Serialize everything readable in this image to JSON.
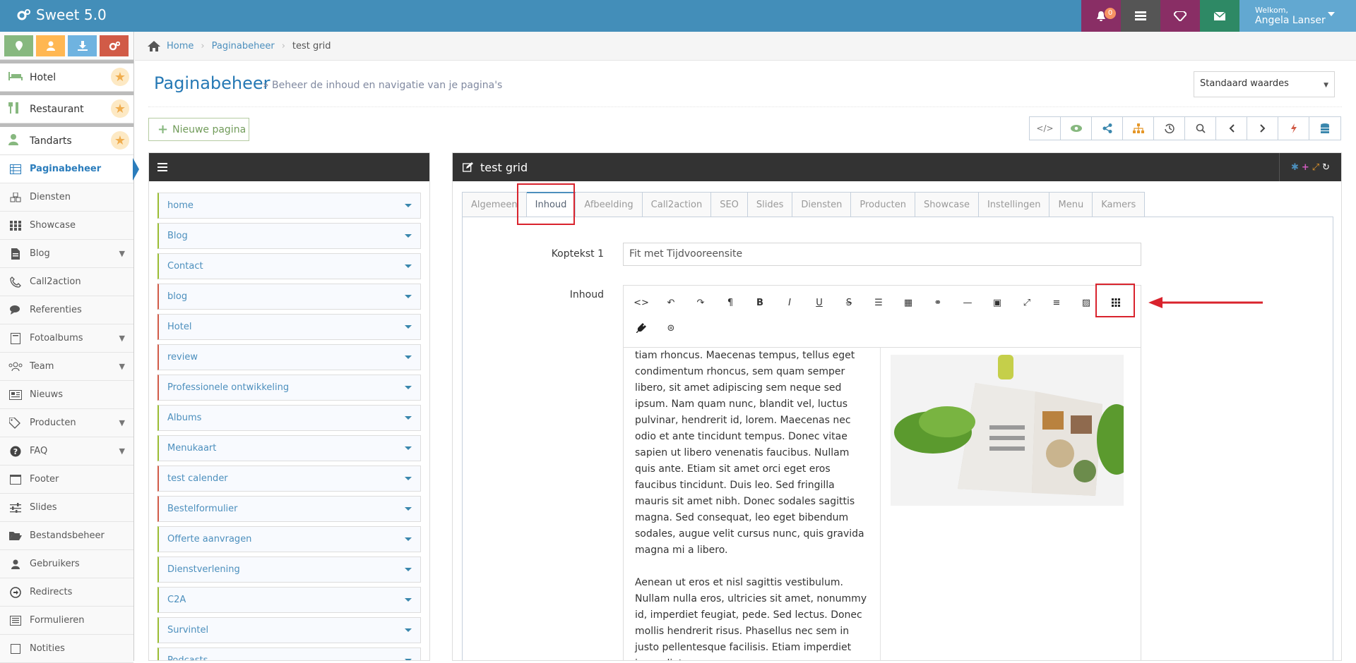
{
  "app": {
    "title": "Sweet 5.0"
  },
  "topbar": {
    "notifications_count": "0",
    "welcome": "Welkom,",
    "user_name": "Angela Lanser"
  },
  "sidebar": {
    "favorites": [
      {
        "label": "Hotel"
      },
      {
        "label": "Restaurant"
      },
      {
        "label": "Tandarts"
      }
    ],
    "items": [
      {
        "label": "Paginabeheer"
      },
      {
        "label": "Diensten"
      },
      {
        "label": "Showcase"
      },
      {
        "label": "Blog"
      },
      {
        "label": "Call2action"
      },
      {
        "label": "Referenties"
      },
      {
        "label": "Fotoalbums"
      },
      {
        "label": "Team"
      },
      {
        "label": "Nieuws"
      },
      {
        "label": "Producten"
      },
      {
        "label": "FAQ"
      },
      {
        "label": "Footer"
      },
      {
        "label": "Slides"
      },
      {
        "label": "Bestandsbeheer"
      },
      {
        "label": "Gebruikers"
      },
      {
        "label": "Redirects"
      },
      {
        "label": "Formulieren"
      },
      {
        "label": "Notities"
      }
    ]
  },
  "breadcrumb": {
    "home": "Home",
    "section": "Paginabeheer",
    "current": "test grid"
  },
  "header": {
    "title": "Paginabeheer",
    "subtitle": "» Beheer de inhoud en navigatie van je pagina's",
    "select_value": "Standaard waardes"
  },
  "actions": {
    "new_page": "Nieuwe pagina"
  },
  "pages": [
    "home",
    "Blog",
    "Contact",
    "blog",
    "Hotel",
    "review",
    "Professionele ontwikkeling",
    "Albums",
    "Menukaart",
    "test calender",
    "Bestelformulier",
    "Offerte aanvragen",
    "Dienstverlening",
    "C2A",
    "Survintel",
    "Podcasts"
  ],
  "editor_panel": {
    "title": "test grid",
    "tabs": [
      "Algemeen",
      "Inhoud",
      "Afbeelding",
      "Call2action",
      "SEO",
      "Slides",
      "Diensten",
      "Producten",
      "Showcase",
      "Instellingen",
      "Menu",
      "Kamers"
    ],
    "koptekst_label": "Koptekst 1",
    "koptekst_value": "Fit met Tijdvooreensite",
    "inhoud_label": "Inhoud",
    "paragraph1": "tiam rhoncus. Maecenas tempus, tellus eget condimentum rhoncus, sem quam semper libero, sit amet adipiscing sem neque sed ipsum. Nam quam nunc, blandit vel, luctus pulvinar, hendrerit id, lorem. Maecenas nec odio et ante tincidunt tempus. Donec vitae sapien ut libero venenatis faucibus. Nullam quis ante. Etiam sit amet orci eget eros faucibus tincidunt. Duis leo. Sed fringilla mauris sit amet nibh. Donec sodales sagittis magna. Sed consequat, leo eget bibendum sodales, augue velit cursus nunc, quis gravida magna mi a libero.",
    "paragraph2": "Aenean ut eros et nisl sagittis vestibulum. Nullam nulla eros, ultricies sit amet, nonummy id, imperdiet feugiat, pede. Sed lectus. Donec mollis hendrerit risus. Phasellus nec sem in justo pellentesque facilisis. Etiam imperdiet imperdiet"
  },
  "colors": {
    "topbar": "#438eb9",
    "highlight": "#d9232d",
    "accent": "#2679b5"
  }
}
